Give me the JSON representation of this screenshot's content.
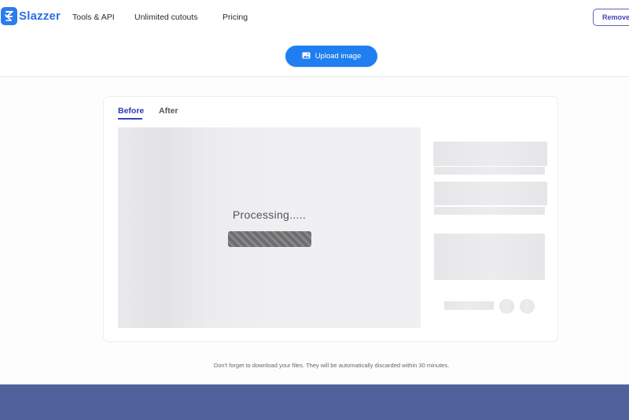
{
  "header": {
    "brand": "Slazzer",
    "nav": [
      {
        "label": "Tools & API"
      },
      {
        "label": "Unlimited cutouts"
      },
      {
        "label": "Pricing"
      }
    ],
    "remove_button": "Remove"
  },
  "upload": {
    "label": "Upload image",
    "icon": "image-icon"
  },
  "editor": {
    "tabs": [
      {
        "label": "Before",
        "active": true
      },
      {
        "label": "After",
        "active": false
      }
    ],
    "status_text": "Processing.....",
    "progress_state": "indeterminate"
  },
  "notice": "Don't forget to download your files. They will be automatically discarded within 30 minutes.",
  "colors": {
    "brand_blue": "#1f7ff0",
    "accent_indigo": "#3a45b4",
    "footer": "#50629c"
  }
}
